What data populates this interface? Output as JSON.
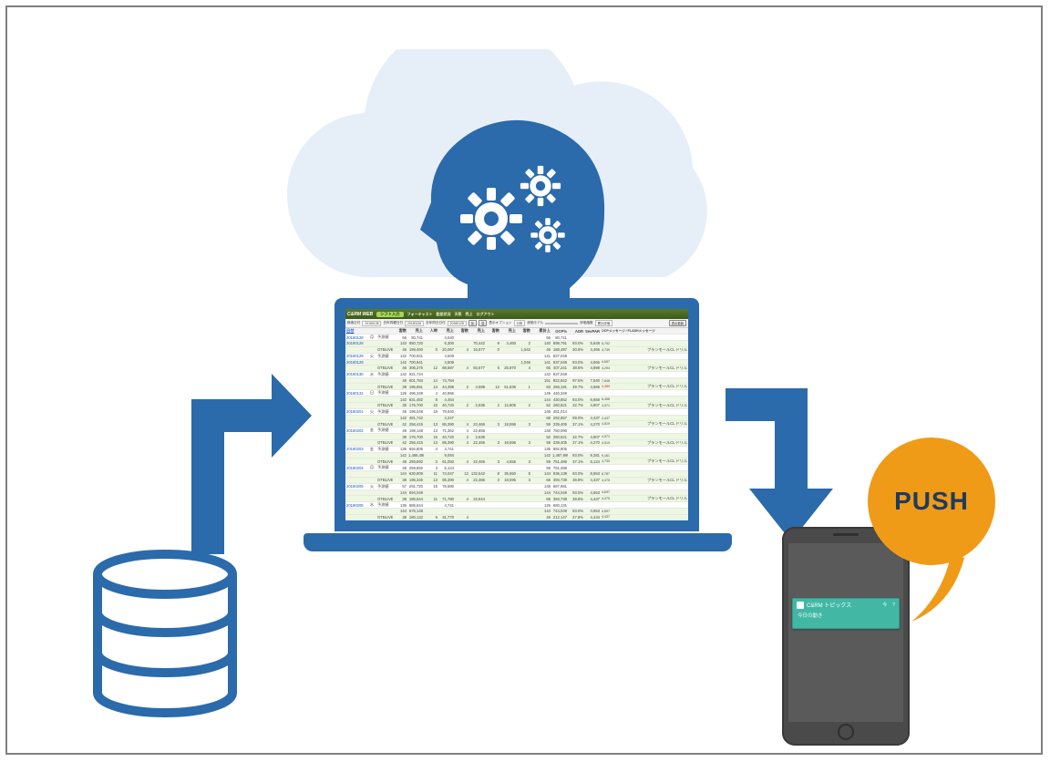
{
  "diagram": {
    "push_label": "PUSH",
    "labels": {
      "database": "database",
      "cloud": "cloud",
      "ai": "ai-processing",
      "laptop": "analytics-app",
      "phone": "mobile-device"
    }
  },
  "app": {
    "title": "C&RM WEB",
    "tabs": [
      "シフト入力",
      "フォーキャスト",
      "勤怠状況",
      "天気",
      "売上",
      "ログアウト"
    ],
    "filters": {
      "date1_label": "検索日付",
      "date1_value": "20180128",
      "date2_label": "去年同曜日付",
      "date2_value": "20180128",
      "date3_label": "去年同日日付",
      "date3_value": "20180128",
      "radio_labels": [
        "前",
        "翌"
      ],
      "unit_label": "表示オプション",
      "unit_value": "日別",
      "select_label": "評価モデル",
      "select_value": "",
      "select2_label": "評価指数",
      "select2_value": "累計評価",
      "btn_search": "表示更新"
    },
    "columns": [
      "日付",
      "",
      "",
      "客数",
      "売上",
      "人時",
      "売上",
      "客数",
      "売上",
      "客数",
      "売上",
      "客数",
      "累計上",
      "OCP%",
      "ADR",
      "SevPAR",
      "OCPメッセージ / FLASHメッセージ"
    ],
    "rows": [
      {
        "date": "20180128",
        "d": "月",
        "lab": "予測値",
        "v": [
          "56",
          "80,741",
          "",
          "4,040",
          "",
          "",
          "",
          "",
          "",
          "56",
          "80,741",
          "",
          "",
          ""
        ],
        "note": ""
      },
      {
        "date": "20180128",
        "d": "",
        "lab": "",
        "cls": "sub",
        "v": [
          "143",
          "850,720",
          "",
          "6,300",
          "",
          "70,442",
          "9",
          "3,460",
          "2",
          "140",
          "898,791",
          "93.0%",
          "5,648",
          "5,792"
        ],
        "note": ""
      },
      {
        "date": "",
        "d": "",
        "lab": "OTBLIVE",
        "cls": "sub",
        "v": [
          "46",
          "199,460",
          "0",
          "20,067",
          "4",
          "16,877",
          "0",
          "",
          "1,542",
          "46",
          "188,487",
          "30.5%",
          "4,466",
          "4,739"
        ],
        "note": "プランモールCL ドリル"
      },
      {
        "date": "20180129",
        "d": "火",
        "lab": "予測値",
        "v": [
          "142",
          "700,941",
          "",
          "4,509",
          "",
          "",
          "",
          "",
          "",
          "141",
          "837,048",
          "",
          "",
          ""
        ],
        "note": ""
      },
      {
        "date": "20180129",
        "d": "",
        "lab": "",
        "cls": "sub",
        "v": [
          "142",
          "700,941",
          "",
          "4,509",
          "",
          "",
          "",
          "",
          "1,046",
          "141",
          "837,048",
          "93.0%",
          "4,665",
          "4,697"
        ],
        "note": ""
      },
      {
        "date": "",
        "d": "",
        "lab": "OTBLIVE",
        "cls": "sub",
        "v": [
          "46",
          "306,275",
          "12",
          "68,687",
          "4",
          "93,677",
          "5",
          "25,870",
          "4",
          "65",
          "407,241",
          "38.5%",
          "4,898",
          "4,294"
        ],
        "note": "プランモールCL ドリル"
      },
      {
        "date": "20180130",
        "d": "水",
        "lab": "予測値",
        "v": [
          "142",
          "621,724",
          "",
          "",
          "",
          "",
          "",
          "",
          "",
          "142",
          "837,048",
          "",
          "",
          ""
        ],
        "note": ""
      },
      {
        "date": "",
        "d": "",
        "lab": "",
        "cls": "sub",
        "v": [
          "46",
          "601,784",
          "14",
          "74,784",
          "",
          "",
          "",
          "",
          "",
          "151",
          "822,842",
          "97.5%",
          "7,640",
          "7,648"
        ],
        "note": ""
      },
      {
        "date": "",
        "d": "",
        "lab": "OTBLIVE",
        "cls": "sub",
        "v": [
          "39",
          "195,651",
          "13",
          "44,398",
          "2",
          "4,598",
          "12",
          "51,636",
          "1",
          "63",
          "266,191",
          "39.7%",
          "4,566",
          "4,489"
        ],
        "note": "プランモールCL ドリル",
        "red": true
      },
      {
        "date": "20180131",
        "d": "日",
        "lab": "予測値",
        "v": [
          "126",
          "496,349",
          "4",
          "40,966",
          "",
          "",
          "",
          "",
          "",
          "149",
          "446,349",
          "",
          "",
          ""
        ],
        "note": ""
      },
      {
        "date": "",
        "d": "",
        "lab": "",
        "cls": "sub",
        "v": [
          "142",
          "631,482",
          "8",
          "4,454",
          "",
          "",
          "",
          "",
          "",
          "144",
          "430,852",
          "93.0%",
          "6,668",
          "6,458"
        ],
        "note": ""
      },
      {
        "date": "",
        "d": "",
        "lab": "OTBLIVE",
        "cls": "sub",
        "v": [
          "38",
          "176,700",
          "15",
          "40,720",
          "2",
          "2,636",
          "2",
          "12,805",
          "2",
          "52",
          "260,621",
          "32.7%",
          "4,807",
          "4,571"
        ],
        "note": "プランモールCL ドリル"
      },
      {
        "date": "20180201",
        "d": "火",
        "lab": "予測値",
        "v": [
          "48",
          "198,048",
          "18",
          "78,640",
          "",
          "",
          "",
          "",
          "",
          "148",
          "481,014",
          "",
          "",
          ""
        ],
        "note": ""
      },
      {
        "date": "",
        "d": "",
        "lab": "",
        "cls": "sub",
        "v": [
          "142",
          "481,742",
          "",
          "4,247",
          "",
          "",
          "",
          "",
          "",
          "66",
          "292,657",
          "99.0%",
          "4,437",
          "4,437"
        ],
        "note": ""
      },
      {
        "date": "",
        "d": "",
        "lab": "OTBLIVE",
        "cls": "sub",
        "v": [
          "42",
          "256,415",
          "13",
          "85,390",
          "4",
          "22,466",
          "3",
          "18,596",
          "3",
          "59",
          "339,405",
          "37.1%",
          "4,270",
          "4,519"
        ],
        "note": "プランモールCL ドリル"
      },
      {
        "date": "20180202",
        "d": "金",
        "lab": "予測値",
        "v": [
          "48",
          "198,148",
          "13",
          "71,362",
          "4",
          "22,656",
          "",
          "",
          "",
          "148",
          "750,090",
          "",
          "",
          ""
        ],
        "note": ""
      },
      {
        "date": "",
        "d": "",
        "lab": "",
        "cls": "sub",
        "v": [
          "38",
          "176,700",
          "15",
          "40,720",
          "2",
          "2,636",
          "",
          "",
          "",
          "52",
          "260,621",
          "32.7%",
          "4,807",
          "4,571"
        ],
        "note": ""
      },
      {
        "date": "",
        "d": "",
        "lab": "OTBLIVE",
        "cls": "sub",
        "v": [
          "42",
          "256,415",
          "13",
          "85,390",
          "4",
          "22,466",
          "3",
          "18,596",
          "3",
          "59",
          "339,405",
          "37.1%",
          "4,270",
          "4,519"
        ],
        "note": "プランモールCL ドリル"
      },
      {
        "date": "20180203",
        "d": "金",
        "lab": "予測値",
        "v": [
          "136",
          "692,805",
          "4",
          "4,741",
          "",
          "",
          "",
          "",
          "",
          "136",
          "892,805",
          "",
          "",
          ""
        ],
        "note": ""
      },
      {
        "date": "",
        "d": "",
        "lab": "",
        "cls": "sub",
        "v": [
          "142",
          "1,466,480",
          "",
          "9,094",
          "",
          "",
          "",
          "",
          "",
          "142",
          "1,467,995",
          "93.0%",
          "9,381",
          "9,161"
        ],
        "note": ""
      },
      {
        "date": "",
        "d": "",
        "lab": "OTBLIVE",
        "cls": "sub",
        "v": [
          "48",
          "259,892",
          "3",
          "61,050",
          "4",
          "22,466",
          "3",
          "4,655",
          "3",
          "59",
          "751,486",
          "37.1%",
          "6,124",
          "4,730"
        ],
        "note": "プランモールCL ドリル"
      },
      {
        "date": "20180204",
        "d": "月",
        "lab": "予測値",
        "v": [
          "48",
          "259,892",
          "3",
          "6,124",
          "",
          "",
          "",
          "",
          "",
          "59",
          "751,486",
          "",
          "",
          ""
        ],
        "note": ""
      },
      {
        "date": "",
        "d": "",
        "lab": "",
        "cls": "sub",
        "v": [
          "144",
          "630,809",
          "11",
          "74,047",
          "12",
          "132,542",
          "8",
          "35,650",
          "5",
          "144",
          "836,139",
          "93.0%",
          "8,553",
          "8,787"
        ],
        "note": ""
      },
      {
        "date": "",
        "d": "",
        "lab": "OTBLIVE",
        "cls": "sub",
        "v": [
          "38",
          "196,345",
          "13",
          "85,390",
          "4",
          "22,466",
          "3",
          "18,596",
          "3",
          "66",
          "393,739",
          "38.8%",
          "4,437",
          "4,475"
        ],
        "note": "プランモールCL ドリル"
      },
      {
        "date": "20180205",
        "d": "火",
        "lab": "予測値",
        "v": [
          "57",
          "291,720",
          "15",
          "78,680",
          "",
          "",
          "",
          "",
          "",
          "148",
          "687,981",
          "",
          "",
          ""
        ],
        "note": ""
      },
      {
        "date": "",
        "d": "",
        "lab": "",
        "cls": "sub",
        "v": [
          "144",
          "694,049",
          "",
          "",
          "",
          "",
          "",
          "",
          "",
          "144",
          "744,049",
          "93.0%",
          "4,653",
          "4,697"
        ],
        "note": ""
      },
      {
        "date": "",
        "d": "",
        "lab": "OTBLIVE",
        "cls": "sub",
        "v": [
          "38",
          "186,644",
          "11",
          "71,780",
          "4",
          "22,644",
          "",
          "",
          "",
          "66",
          "393,739",
          "38.8%",
          "4,437",
          "4,475"
        ],
        "note": "プランモールCL ドリル"
      },
      {
        "date": "20180206",
        "d": "水",
        "lab": "予測値",
        "v": [
          "136",
          "686,644",
          "",
          "4,741",
          "",
          "",
          "",
          "",
          "",
          "126",
          "680,131",
          "",
          "",
          ""
        ],
        "note": ""
      },
      {
        "date": "",
        "d": "",
        "lab": "",
        "cls": "sub",
        "v": [
          "144",
          "676,148",
          "",
          "",
          "",
          "",
          "",
          "",
          "",
          "144",
          "744,049",
          "93.0%",
          "4,653",
          "4,697"
        ],
        "note": ""
      },
      {
        "date": "",
        "d": "",
        "lab": "OTBLIVE",
        "cls": "sub",
        "v": [
          "38",
          "180,132",
          "6",
          "31,770",
          "4",
          "",
          "",
          "",
          "",
          "46",
          "212,147",
          "27.8%",
          "4,434",
          "4,437"
        ],
        "note": ""
      }
    ]
  },
  "notification": {
    "app_name": "C&RM トピックス",
    "time": "今",
    "body": "今日の動き",
    "symbol": "?"
  },
  "colors": {
    "brand_blue": "#2b6aab",
    "cloud_fill": "#e6eff8",
    "accent_orange": "#ef9b17",
    "notification": "#42b8a4",
    "phone": "#4a4a4a"
  }
}
